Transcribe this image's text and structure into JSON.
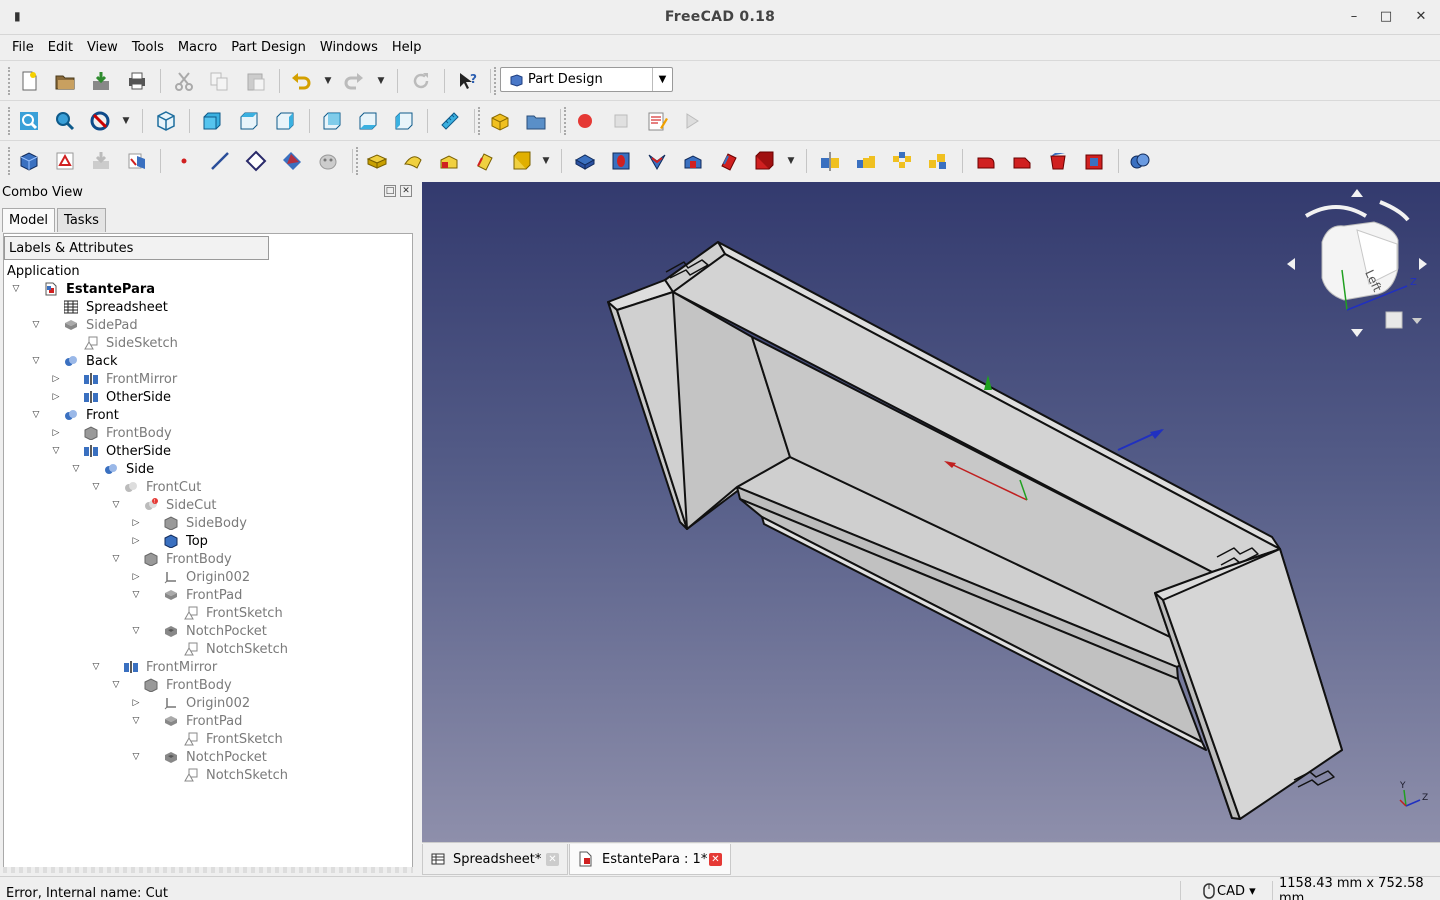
{
  "window": {
    "title": "FreeCAD 0.18",
    "minimize": "–",
    "maximize": "□",
    "close": "✕"
  },
  "menubar": [
    "File",
    "Edit",
    "View",
    "Tools",
    "Macro",
    "Part Design",
    "Windows",
    "Help"
  ],
  "workbench": {
    "selected": "Part Design"
  },
  "combo_view": {
    "title": "Combo View",
    "tabs": [
      "Model",
      "Tasks"
    ],
    "header": "Labels & Attributes",
    "root": "Application",
    "tree": [
      {
        "label": "EstantePara",
        "depth": 0,
        "twisty": "open",
        "icon": "document-icon",
        "style": "bold"
      },
      {
        "label": "Spreadsheet",
        "depth": 1,
        "twisty": "none",
        "icon": "spreadsheet-icon",
        "style": "normal"
      },
      {
        "label": "SidePad",
        "depth": 1,
        "twisty": "open",
        "icon": "pad-icon",
        "style": "dim"
      },
      {
        "label": "SideSketch",
        "depth": 2,
        "twisty": "none",
        "icon": "sketch-icon",
        "style": "dim"
      },
      {
        "label": "Back",
        "depth": 1,
        "twisty": "open",
        "icon": "boolean-icon",
        "style": "normal"
      },
      {
        "label": "FrontMirror",
        "depth": 2,
        "twisty": "closed",
        "icon": "mirror-icon",
        "style": "dim"
      },
      {
        "label": "OtherSide",
        "depth": 2,
        "twisty": "closed",
        "icon": "mirror-icon",
        "style": "normal"
      },
      {
        "label": "Front",
        "depth": 1,
        "twisty": "open",
        "icon": "boolean-icon",
        "style": "normal"
      },
      {
        "label": "FrontBody",
        "depth": 2,
        "twisty": "closed",
        "icon": "body-icon",
        "style": "dim"
      },
      {
        "label": "OtherSide",
        "depth": 2,
        "twisty": "open",
        "icon": "mirror-icon",
        "style": "normal"
      },
      {
        "label": "Side",
        "depth": 3,
        "twisty": "open",
        "icon": "boolean-icon",
        "style": "normal"
      },
      {
        "label": "FrontCut",
        "depth": 4,
        "twisty": "open",
        "icon": "cut-icon",
        "style": "dim"
      },
      {
        "label": "SideCut",
        "depth": 5,
        "twisty": "open",
        "icon": "cut-error-icon",
        "style": "dim"
      },
      {
        "label": "SideBody",
        "depth": 6,
        "twisty": "closed",
        "icon": "body-icon",
        "style": "dim"
      },
      {
        "label": "Top",
        "depth": 6,
        "twisty": "closed",
        "icon": "body-active-icon",
        "style": "normal"
      },
      {
        "label": "FrontBody",
        "depth": 5,
        "twisty": "open",
        "icon": "body-icon",
        "style": "dim"
      },
      {
        "label": "Origin002",
        "depth": 6,
        "twisty": "closed",
        "icon": "origin-icon",
        "style": "dim"
      },
      {
        "label": "FrontPad",
        "depth": 6,
        "twisty": "open",
        "icon": "pad-icon",
        "style": "dim"
      },
      {
        "label": "FrontSketch",
        "depth": 7,
        "twisty": "none",
        "icon": "sketch-icon",
        "style": "dim"
      },
      {
        "label": "NotchPocket",
        "depth": 6,
        "twisty": "open",
        "icon": "pocket-icon",
        "style": "dim"
      },
      {
        "label": "NotchSketch",
        "depth": 7,
        "twisty": "none",
        "icon": "sketch-icon",
        "style": "dim"
      },
      {
        "label": "FrontMirror",
        "depth": 4,
        "twisty": "open",
        "icon": "mirror-icon",
        "style": "dim"
      },
      {
        "label": "FrontBody",
        "depth": 5,
        "twisty": "open",
        "icon": "body-icon",
        "style": "dim"
      },
      {
        "label": "Origin002",
        "depth": 6,
        "twisty": "closed",
        "icon": "origin-icon",
        "style": "dim"
      },
      {
        "label": "FrontPad",
        "depth": 6,
        "twisty": "open",
        "icon": "pad-icon",
        "style": "dim"
      },
      {
        "label": "FrontSketch",
        "depth": 7,
        "twisty": "none",
        "icon": "sketch-icon",
        "style": "dim"
      },
      {
        "label": "NotchPocket",
        "depth": 6,
        "twisty": "open",
        "icon": "pocket-icon",
        "style": "dim"
      },
      {
        "label": "NotchSketch",
        "depth": 7,
        "twisty": "none",
        "icon": "sketch-icon",
        "style": "dim"
      }
    ]
  },
  "navcube": {
    "face": "Left",
    "axis_label": "Z"
  },
  "axis_indicator": {
    "y": "Y",
    "z": "Z"
  },
  "mdi_tabs": [
    {
      "label": "Spreadsheet*",
      "active": false
    },
    {
      "label": "EstantePara : 1*",
      "active": true
    }
  ],
  "statusbar": {
    "message": "Error, Internal name: Cut",
    "nav_style": "CAD ▾",
    "dimensions": "1158.43 mm x 752.58 mm"
  },
  "colors": {
    "accent_red": "#e53935",
    "viewport_top": "#333a6e",
    "viewport_bottom": "#8e8fab",
    "part_face": "#d2d2d2"
  }
}
